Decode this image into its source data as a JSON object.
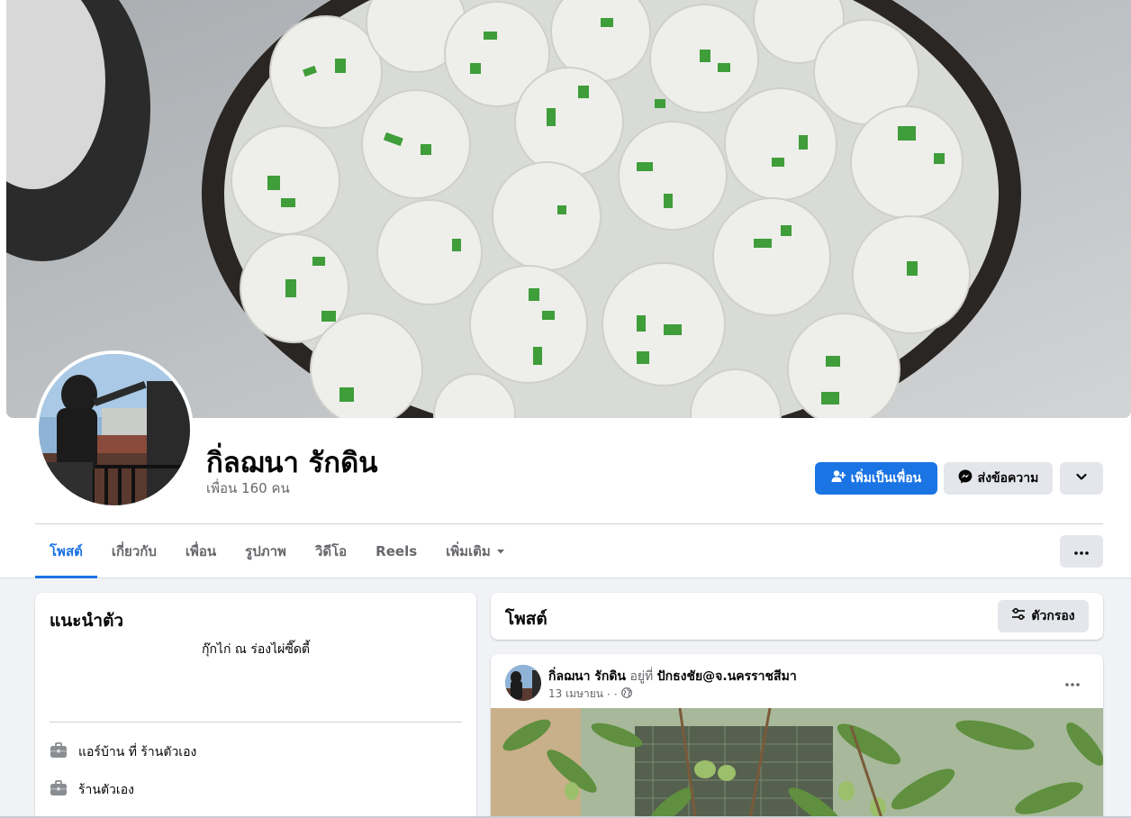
{
  "profile": {
    "name": "กิ่ลฌนา รักดิน",
    "friends": "เพื่อน 160 คน"
  },
  "actions": {
    "add_friend": "เพิ่มเป็นเพื่อน",
    "message": "ส่งข้อความ"
  },
  "tabs": [
    {
      "label": "โพสต์",
      "active": true
    },
    {
      "label": "เกี่ยวกับ",
      "active": false
    },
    {
      "label": "เพื่อน",
      "active": false
    },
    {
      "label": "รูปภาพ",
      "active": false
    },
    {
      "label": "วิดีโอ",
      "active": false
    },
    {
      "label": "Reels",
      "active": false
    },
    {
      "label": "เพิ่มเติม",
      "active": false
    }
  ],
  "intro": {
    "title": "แนะนำตัว",
    "bio": "กุ๊กไก่ ณ ร่องไผ่ซี๊ดตี้",
    "items": [
      {
        "icon": "briefcase-icon",
        "text": "แอร์บ้าน ที่ ร้านตัวเอง"
      },
      {
        "icon": "briefcase-icon",
        "text": "ร้านตัวเอง"
      }
    ]
  },
  "posts": {
    "title": "โพสต์",
    "filter_label": "ตัวกรอง"
  },
  "post": {
    "author": "กิ่ลฌนา รักดิน",
    "at": "อยู่ที่",
    "place": "ปักธงชัย@จ.นครราชสีมา",
    "date": "13 เมษายน",
    "sep": "·",
    "privacy_icon": "globe-icon"
  },
  "colors": {
    "primary": "#1b74e4",
    "button_gray": "#e4e6eb",
    "secondary_text": "#65676b",
    "page_bg": "#f0f2f5"
  }
}
